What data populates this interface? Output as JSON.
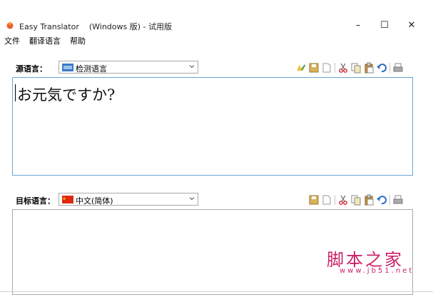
{
  "window": {
    "title": "Easy Translator    (Windows 版) - 试用版",
    "minimize_glyph": "–",
    "maximize_glyph": "☐",
    "close_glyph": "✕"
  },
  "menu": [
    {
      "label": "文件"
    },
    {
      "label": "翻译语言"
    },
    {
      "label": "帮助"
    }
  ],
  "source": {
    "label": "源语言：",
    "selected": "检测语言",
    "text": "お元気ですか?",
    "flag_icon": "detect-language-flag"
  },
  "target": {
    "label": "目标语言：",
    "selected": "中文(简体)",
    "text": "",
    "flag_icon": "china-flag"
  },
  "toolbar_icons": [
    "translate-icon",
    "save-icon",
    "new-icon",
    "cut-icon",
    "copy-icon",
    "paste-icon",
    "undo-icon",
    "print-icon"
  ],
  "watermark": {
    "cn": "脚本之家",
    "en": "www.jb51.net"
  },
  "colors": {
    "border_focus": "#6aa6d6",
    "watermark": "#cc2266"
  }
}
